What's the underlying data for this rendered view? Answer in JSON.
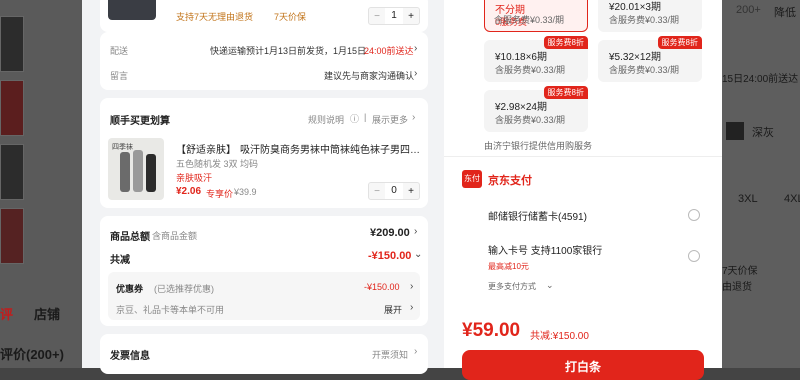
{
  "background": {
    "left_items": [
      "评",
      "店铺",
      "评价(200+)"
    ],
    "right_items": [
      "200+",
      "降低",
      "15日24:00前送达",
      "深灰",
      "3XL",
      "4XL",
      "7天价保",
      "由退货"
    ]
  },
  "product": {
    "return_note": "支持7天无理由退货",
    "price_guarantee": "7天价保",
    "quantity": "1",
    "minus": "−",
    "plus": "+"
  },
  "delivery": {
    "label": "配送",
    "value_prefix": "快递运输预计1月13日前发货，1月15日",
    "value_highlight": "24:00前送达",
    "remark_label": "留言",
    "remark_value": "建议先与商家沟通确认"
  },
  "addon": {
    "title": "顺手买更划算",
    "rules_link": "规则说明",
    "expand_link": "展示更多",
    "item_brand": "【舒适亲肤】",
    "item_title": "吸汗防臭商务男袜中筒袜纯色袜子男四…",
    "item_spec": "五色随机发 3双 均码",
    "item_feature": "亲肤吸汗",
    "item_price": "¥2.06",
    "item_price_tag": "专享价",
    "item_original": "¥39.9",
    "item_quantity": "0",
    "thumb_label": "四季袜"
  },
  "summary": {
    "total_label": "商品总额",
    "total_sub": "含商品金额",
    "total_value": "¥209.00",
    "discount_label": "共减",
    "discount_value": "-¥150.00",
    "coupon_label": "优惠券",
    "coupon_sub": "(已选推荐优惠)",
    "coupon_value": "-¥150.00",
    "card_label": "京豆、礼品卡等本单不可用",
    "card_action": "展开"
  },
  "invoice": {
    "label": "发票信息",
    "action": "开票须知"
  },
  "installments": {
    "selected_title": "不分期",
    "selected_sub": "0服务费",
    "top_right_title": "¥20.01×3期",
    "top_right_sub": "含服务费¥0.33/期",
    "top_mid_sub": "含服务费¥0.33/期",
    "plans": [
      {
        "tag": "服务费8折",
        "title": "¥10.18×6期",
        "sub": "含服务费¥0.33/期"
      },
      {
        "tag": "服务费8折",
        "title": "¥5.32×12期",
        "sub": "含服务费¥0.33/期"
      },
      {
        "tag": "服务费8折",
        "title": "¥2.98×24期",
        "sub": "含服务费¥0.33/期"
      }
    ],
    "provider": "由济宁银行提供信用购服务"
  },
  "payment": {
    "brand_icon": "东付",
    "brand": "京东支付",
    "option1": "邮储银行储蓄卡(4591)",
    "option2": "输入卡号 支持1100家银行",
    "option2_promo": "最高减10元",
    "more": "更多支付方式"
  },
  "footer": {
    "total": "¥59.00",
    "saved": "共减:¥150.00",
    "pay_button": "打白条"
  },
  "colors": {
    "accent": "#e1251b",
    "panel": "#f2f3f5"
  }
}
